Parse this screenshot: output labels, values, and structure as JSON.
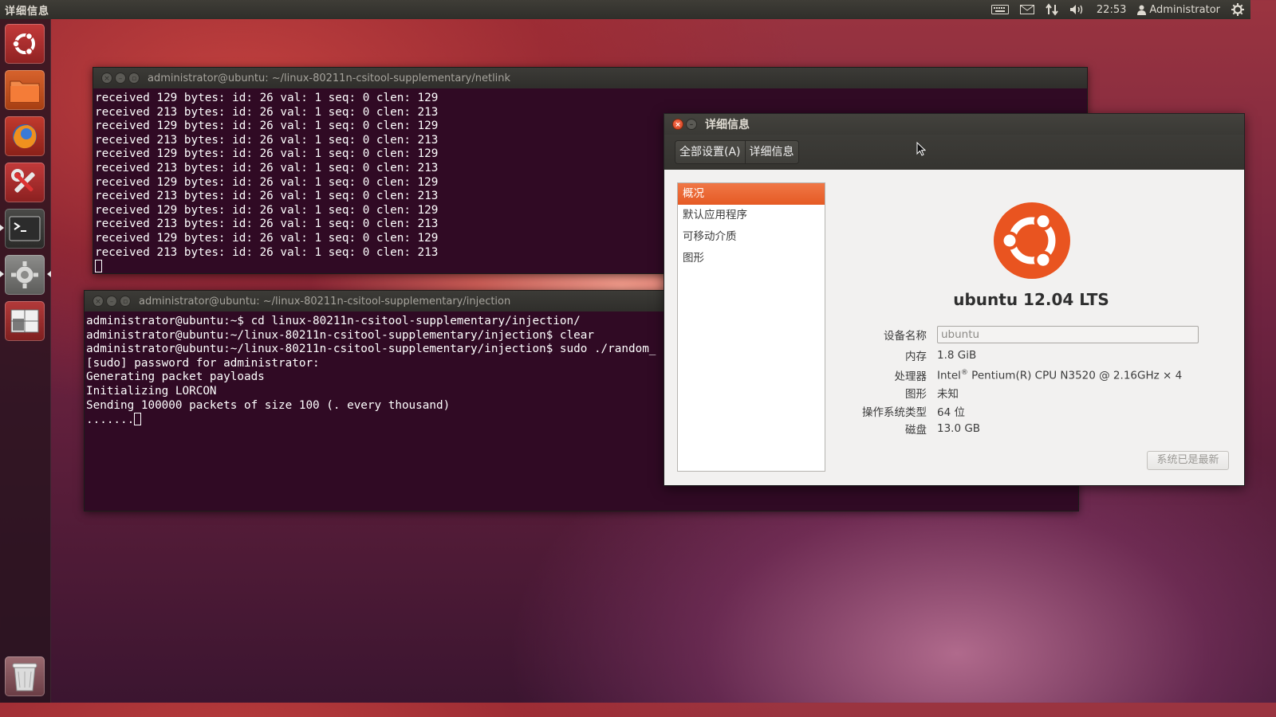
{
  "top_panel": {
    "app_title": "详细信息",
    "clock": "22:53",
    "user": "Administrator",
    "icons": [
      "keyboard-icon",
      "mail-icon",
      "network-icon",
      "volume-icon",
      "user-icon",
      "gear-icon"
    ]
  },
  "launcher": {
    "items": [
      "dash-home",
      "files",
      "firefox",
      "system-tools",
      "terminal",
      "system-settings",
      "workspace-switcher",
      "trash"
    ]
  },
  "terminal_netlink": {
    "title": "administrator@ubuntu: ~/linux-80211n-csitool-supplementary/netlink",
    "lines": [
      "received 129 bytes: id: 26 val: 1 seq: 0 clen: 129",
      "received 213 bytes: id: 26 val: 1 seq: 0 clen: 213",
      "received 129 bytes: id: 26 val: 1 seq: 0 clen: 129",
      "received 213 bytes: id: 26 val: 1 seq: 0 clen: 213",
      "received 129 bytes: id: 26 val: 1 seq: 0 clen: 129",
      "received 213 bytes: id: 26 val: 1 seq: 0 clen: 213",
      "received 129 bytes: id: 26 val: 1 seq: 0 clen: 129",
      "received 213 bytes: id: 26 val: 1 seq: 0 clen: 213",
      "received 129 bytes: id: 26 val: 1 seq: 0 clen: 129",
      "received 213 bytes: id: 26 val: 1 seq: 0 clen: 213",
      "received 129 bytes: id: 26 val: 1 seq: 0 clen: 129",
      "received 213 bytes: id: 26 val: 1 seq: 0 clen: 213"
    ]
  },
  "terminal_injection": {
    "title": "administrator@ubuntu: ~/linux-80211n-csitool-supplementary/injection",
    "lines": [
      "administrator@ubuntu:~$ cd linux-80211n-csitool-supplementary/injection/",
      "administrator@ubuntu:~/linux-80211n-csitool-supplementary/injection$ clear",
      "administrator@ubuntu:~/linux-80211n-csitool-supplementary/injection$ sudo ./random_",
      "[sudo] password for administrator:",
      "Generating packet payloads",
      "Initializing LORCON",
      "Sending 100000 packets of size 100 (. every thousand)"
    ],
    "progress_line": "......."
  },
  "details": {
    "title": "详细信息",
    "breadcrumbs": [
      "全部设置(A)",
      "详细信息"
    ],
    "sidebar": [
      "概况",
      "默认应用程序",
      "可移动介质",
      "图形"
    ],
    "os_name": "ubuntu 12.04 LTS",
    "device_name_label": "设备名称",
    "device_name_value": "ubuntu",
    "memory_label": "内存",
    "memory_value": "1.8 GiB",
    "processor_label": "处理器",
    "processor_brand": "Intel",
    "processor_mark": "®",
    "processor_value": " Pentium(R) CPU N3520 @ 2.16GHz × 4",
    "graphics_label": "图形",
    "graphics_value": "未知",
    "os_type_label": "操作系统类型",
    "os_type_value": "64 位",
    "disk_label": "磁盘",
    "disk_value": "13.0 GB",
    "update_button": "系统已是最新"
  },
  "colors": {
    "terminal_bg": "#300a24",
    "accent": "#e95420",
    "panel_bg": "#3c3b37"
  }
}
